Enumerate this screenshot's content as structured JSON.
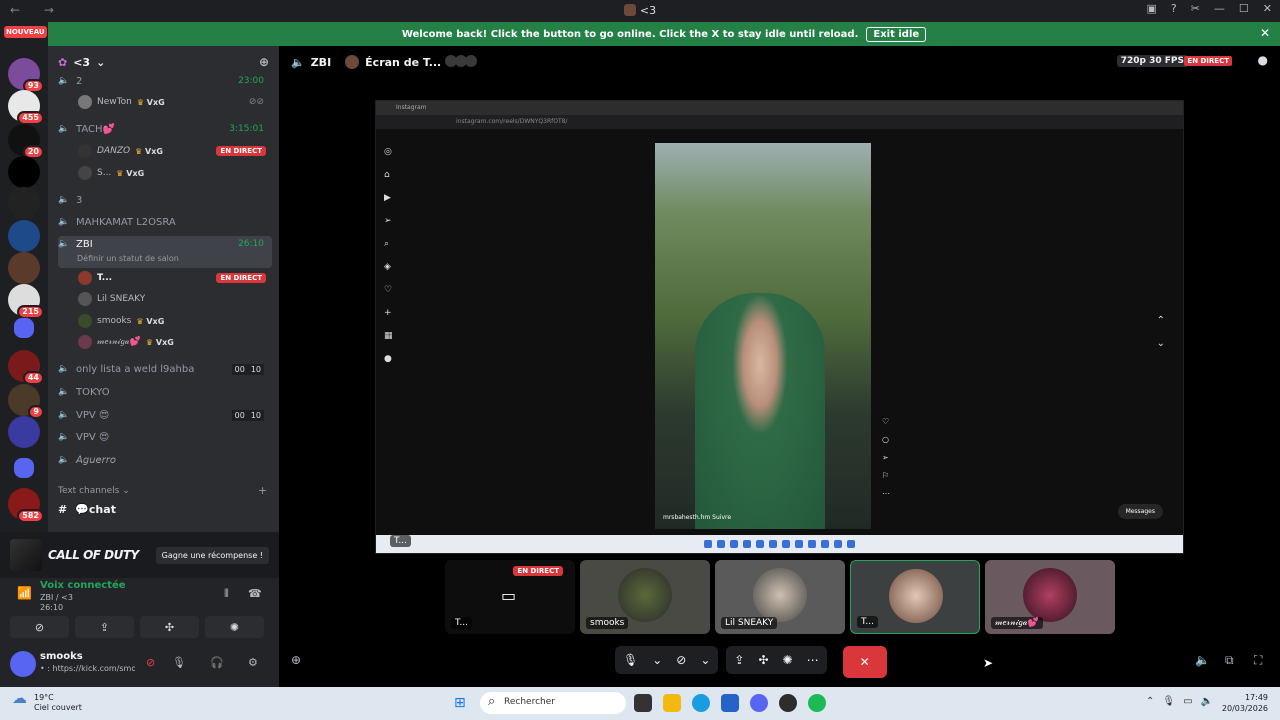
{
  "titlebar": {
    "title": "<3"
  },
  "banner": {
    "message": "Welcome back! Click the button to go online. Click the X to stay idle until reload.",
    "exit_label": "Exit idle"
  },
  "rail": {
    "nouveau": "NOUVEAU",
    "badges": [
      "93",
      "455",
      "20",
      "215",
      "44",
      "9",
      "582"
    ]
  },
  "server": {
    "name": "<3"
  },
  "channels": {
    "c2": {
      "name": "2",
      "time": "23:00"
    },
    "newton": {
      "name": "NewTon",
      "tag": "VxG"
    },
    "tach": {
      "name": "TACH💕",
      "time": "3:15:01"
    },
    "danzo": {
      "name": "DANZO",
      "tag": "VxG",
      "live": "EN DIRECT"
    },
    "s": {
      "name": "S...",
      "tag": "VxG"
    },
    "c3": {
      "name": "3"
    },
    "mahkamat": {
      "name": "MAHKAMAT L2OSRA"
    },
    "zbi": {
      "name": "ZBI",
      "time": "26:10",
      "sub": "Définir un statut de salon"
    },
    "t": {
      "name": "T...",
      "live": "EN DIRECT"
    },
    "lilsneaky": {
      "name": "Lil SNEAKY"
    },
    "smooks": {
      "name": "smooks",
      "tag": "VxG"
    },
    "merniga": {
      "name": "𝓂𝑒𝓇𝓃𝒾𝑔𝒶💕",
      "tag": "VxG"
    },
    "onlylista": {
      "name": "only lista a weld l9ahba",
      "c1": "00",
      "c2": "10"
    },
    "tokyo": {
      "name": "TOKYO"
    },
    "vpv1": {
      "name": "VPV 😍",
      "c1": "00",
      "c2": "10"
    },
    "vpv2": {
      "name": "VPV 😍"
    },
    "aguerro": {
      "name": "𝘈𝘨𝘶𝘦𝘳𝘳𝘰"
    },
    "textcat": "Text channels",
    "chat": "💬chat"
  },
  "promo": {
    "title": "CALL OF DUTY",
    "button": "Gagne une récompense !"
  },
  "voice": {
    "status": "Voix connectée",
    "sub": "ZBI / <3",
    "time": "26:10"
  },
  "user": {
    "name": "smooks",
    "status": "• : https://kick.com/smo"
  },
  "stage": {
    "channel": "ZBI",
    "screen": "Écran de T...",
    "quality": "720p 30 FPS",
    "live": "EN DIRECT"
  },
  "share": {
    "tab": "Instagram",
    "url": "instagram.com/reels/DWNYQ3RfOT8/",
    "handle": "mrsbahesth.hm  Suivre",
    "messages": "Messages",
    "presenter": "T..."
  },
  "tiles": [
    {
      "label": "T...",
      "live": "EN DIRECT"
    },
    {
      "label": "smooks"
    },
    {
      "label": "Lil SNEAKY"
    },
    {
      "label": "T..."
    },
    {
      "label": "𝓂𝑒𝓇𝓃𝒾𝑔𝒶💕"
    }
  ],
  "taskbar": {
    "temp": "19°C",
    "weather": "Ciel couvert",
    "search": "Rechercher",
    "time": "17:49",
    "date": "20/03/2026"
  }
}
